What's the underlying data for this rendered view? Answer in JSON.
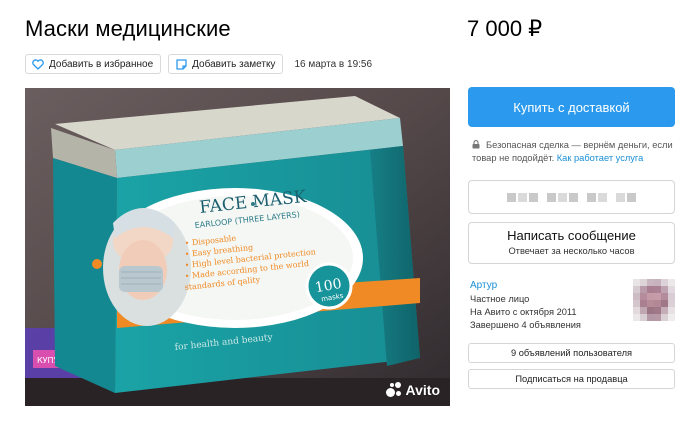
{
  "listing": {
    "title": "Маски медицинские",
    "price": "7 000 ₽"
  },
  "toolbar": {
    "favorite_label": "Добавить в избранное",
    "note_label": "Добавить заметку",
    "date": "16 марта в 19:56"
  },
  "photo": {
    "box_brand": "FACE MASK",
    "box_subtitle": "EARLOOP (THREE LAYERS)",
    "box_features": [
      "• Disposable",
      "• Easy breathing",
      "• High level bacterial protection",
      "• Made according to the world",
      "  standards of qality"
    ],
    "box_badge_number": "100",
    "box_badge_unit": "masks",
    "box_footer": "for health and beauty",
    "watermark": "Avito"
  },
  "sidebar": {
    "buy_button": "Купить с доставкой",
    "safe_deal_text": "Безопасная сделка — вернём деньги, если товар не подойдёт.",
    "safe_deal_link": "Как работает услуга",
    "message_button": "Написать сообщение",
    "message_subtext": "Отвечает за несколько часов",
    "seller_name": "Артур",
    "seller_type": "Частное лицо",
    "seller_since": "На Авито с октября 2011",
    "seller_completed": "Завершено 4 объявления",
    "seller_ads_button": "9 объявлений пользователя",
    "subscribe_button": "Подписаться на продавца"
  },
  "colors": {
    "accent": "#2b9aee",
    "link": "#1a8fd6",
    "box_teal": "#1f9ea0",
    "box_orange": "#f08a24"
  },
  "icons": {
    "favorite": "heart-icon",
    "note": "note-icon",
    "safe": "lock-icon",
    "watermark": "avito-logo-icon"
  }
}
